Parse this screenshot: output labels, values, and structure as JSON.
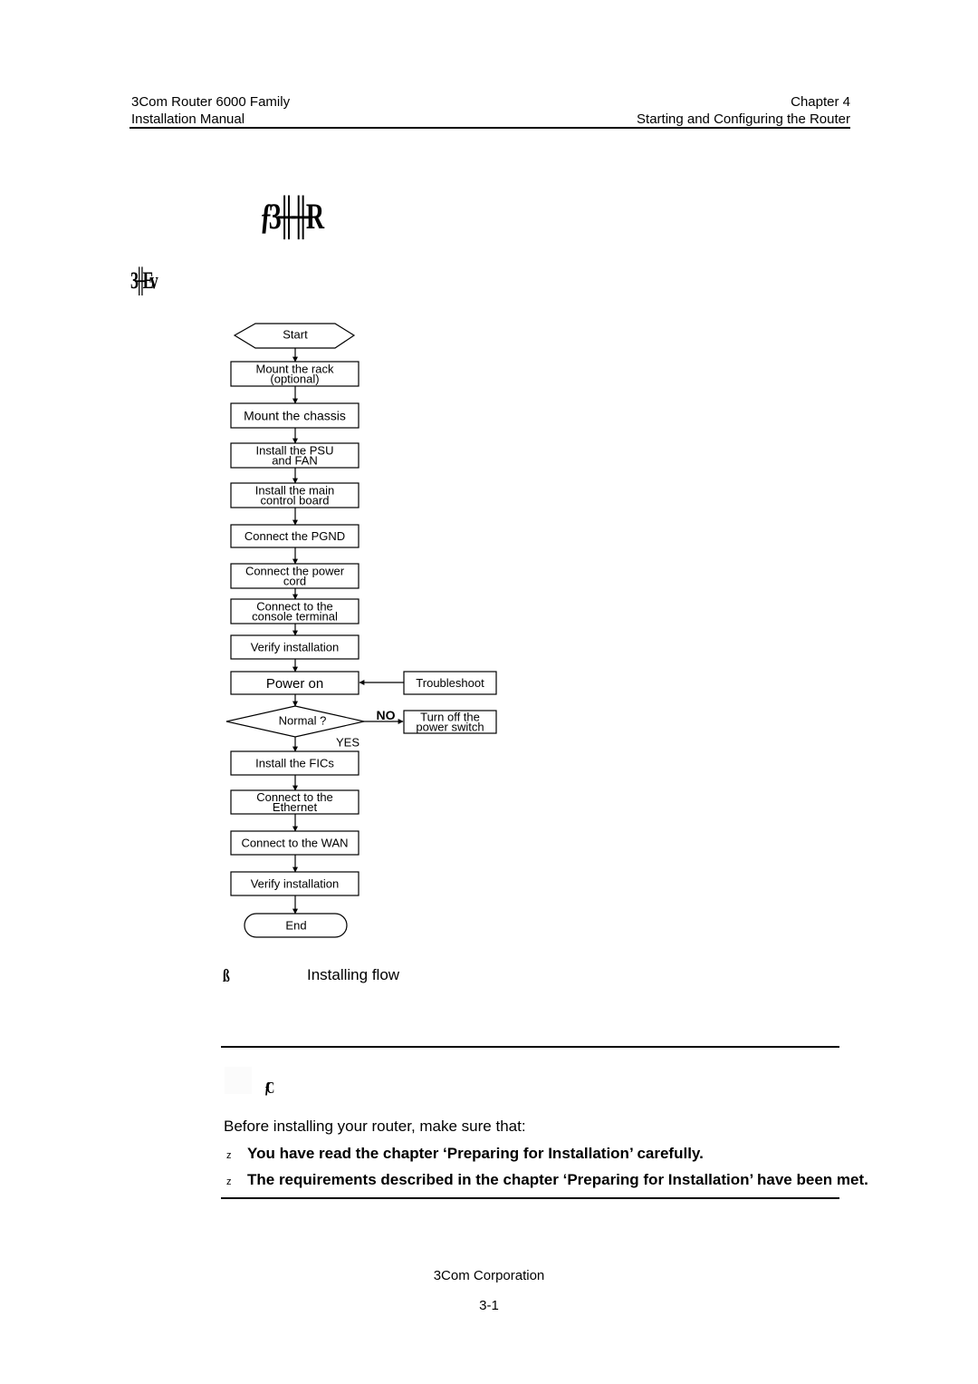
{
  "header": {
    "left_line1": "3Com Router 6000 Family",
    "left_line2": "Installation Manual",
    "right_line1": "Chapter 4",
    "right_line2": "Starting and Configuring the Router"
  },
  "chapter_title_garbled": "ƒ3╫╫R",
  "section_title_garbled": "3╫Ev",
  "flowchart": {
    "start": "Start",
    "steps": [
      [
        "Mount the rack",
        "(optional)"
      ],
      [
        "Mount the chassis"
      ],
      [
        "Install the PSU",
        "and FAN"
      ],
      [
        "Install the main",
        "control board"
      ],
      [
        "Connect the PGND"
      ],
      [
        "Connect the power",
        "cord"
      ],
      [
        "Connect to the",
        "console terminal"
      ],
      [
        "Verify installation"
      ]
    ],
    "power_on": "Power on",
    "decision": "Normal ?",
    "yes_label": "YES",
    "no_label": "NO",
    "troubleshoot": "Troubleshoot",
    "turn_off": [
      "Turn off the",
      "power switch"
    ],
    "steps_after": [
      [
        "Install the FICs"
      ],
      [
        "Connect to the",
        "Ethernet"
      ],
      [
        "Connect to the WAN"
      ],
      [
        "Verify installation"
      ]
    ],
    "end": "End"
  },
  "figure": {
    "number_garbled": "ß",
    "caption": "Installing flow"
  },
  "note": {
    "label_garbled": "ƒC",
    "intro": "Before installing your router, make sure that:",
    "bullet_mark": "z",
    "bullets": [
      "You have read the chapter ‘Preparing for Installation’ carefully.",
      "The requirements described in the chapter ‘Preparing for Installation’ have been met."
    ]
  },
  "footer": {
    "company": "3Com Corporation",
    "page": "3-1"
  }
}
